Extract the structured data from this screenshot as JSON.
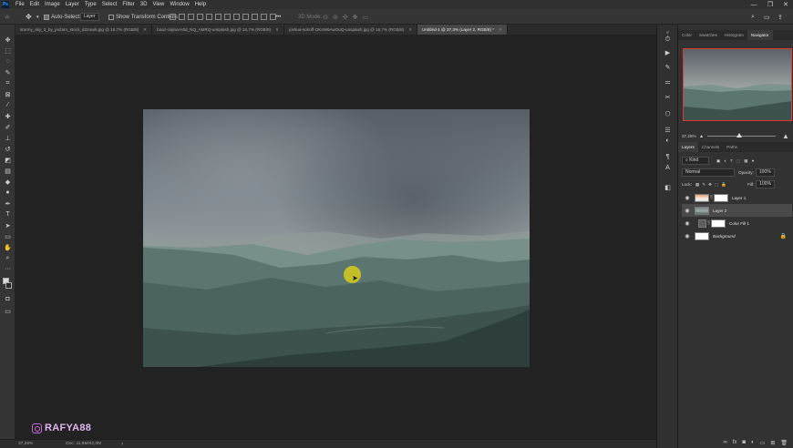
{
  "menubar": {
    "logo": "Ps",
    "items": [
      "File",
      "Edit",
      "Image",
      "Layer",
      "Type",
      "Select",
      "Filter",
      "3D",
      "View",
      "Window",
      "Help"
    ]
  },
  "window_controls": {
    "minimize": "—",
    "restore": "❐",
    "close": "✕"
  },
  "options_bar": {
    "auto_select_label": "Auto-Select:",
    "auto_select_target": "Layer",
    "show_transform_label": "Show Transform Controls",
    "mode_3d": "3D Mode:"
  },
  "tabs": [
    {
      "label": "stormy_sky_3_by_jecfarn_stock_d22oark.jpg @ 16,7% (RGB/8)",
      "active": false
    },
    {
      "label": "boaz-cajina-H0d_NQ_AMRQ-unsplash.jpg @ 16,7% (RGB/8)",
      "active": false
    },
    {
      "label": "joshua-sokoff-OKsW6AwOuQ-unsplash.jpg @ 16,7% (RGB/8)",
      "active": false
    },
    {
      "label": "Untitled-1 @ 37,3% (Layer 2, RGB/8) *",
      "active": true
    }
  ],
  "status": {
    "zoom": "37,26%",
    "doc": "Doc: 11,9M/42,0M"
  },
  "watermark": {
    "handle": "RAFYA88"
  },
  "panels": {
    "top_tabs": [
      "Color",
      "Swatches",
      "Histogram",
      "Navigator"
    ],
    "active_top_tab": "Navigator",
    "navigator_zoom": "37,26%",
    "navigator_zoom_fraction": 0.47,
    "layer_tabs": [
      "Layers",
      "Channels",
      "Paths"
    ],
    "filter_kind": "Kind",
    "blend_mode": "Normal",
    "opacity_label": "Opacity:",
    "opacity_value": "100%",
    "lock_label": "Lock:",
    "fill_label": "Fill:",
    "fill_value": "100%",
    "layers": [
      {
        "name": "Layer 1",
        "selected": false,
        "thumb": "gradient"
      },
      {
        "name": "Layer 2",
        "selected": true,
        "thumb": "photo"
      },
      {
        "name": "Color Fill 1",
        "selected": false,
        "thumb": "grey"
      },
      {
        "name": "Background",
        "selected": false,
        "thumb": "white",
        "locked": true
      }
    ]
  },
  "colors": {
    "accent_navigator": "#e03a2f",
    "cursor_highlight": "#d6cc1c",
    "watermark": "#c46ad9"
  }
}
